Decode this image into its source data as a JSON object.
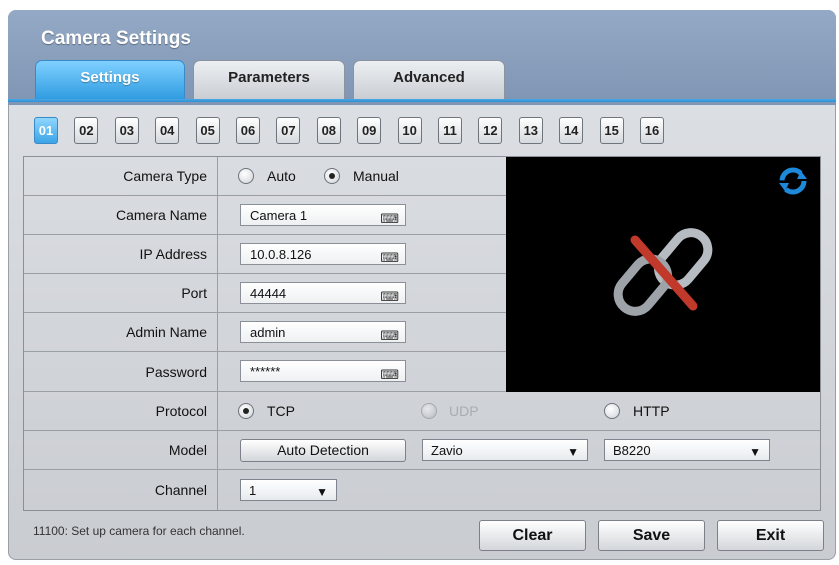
{
  "window": {
    "title": "Camera Settings"
  },
  "tabs": [
    {
      "label": "Settings",
      "active": true
    },
    {
      "label": "Parameters",
      "active": false
    },
    {
      "label": "Advanced",
      "active": false
    }
  ],
  "channels": {
    "items": [
      "01",
      "02",
      "03",
      "04",
      "05",
      "06",
      "07",
      "08",
      "09",
      "10",
      "11",
      "12",
      "13",
      "14",
      "15",
      "16"
    ],
    "selected": "01"
  },
  "form": {
    "camera_type": {
      "label": "Camera Type",
      "options": [
        "Auto",
        "Manual"
      ],
      "selected": "Manual"
    },
    "camera_name": {
      "label": "Camera Name",
      "value": "Camera 1"
    },
    "ip_address": {
      "label": "IP Address",
      "value": "10.0.8.126"
    },
    "port": {
      "label": "Port",
      "value": "44444"
    },
    "admin_name": {
      "label": "Admin Name",
      "value": "admin"
    },
    "password": {
      "label": "Password",
      "value": "******"
    },
    "protocol": {
      "label": "Protocol",
      "options": [
        "TCP",
        "UDP",
        "HTTP"
      ],
      "selected": "TCP",
      "disabled": [
        "UDP"
      ]
    },
    "model": {
      "label": "Model",
      "auto_detect_label": "Auto Detection",
      "brand": "Zavio",
      "model": "B8220"
    },
    "channel": {
      "label": "Channel",
      "value": "1"
    }
  },
  "preview": {
    "status_icon": "broken-link-icon",
    "refresh_icon": "refresh-icon"
  },
  "status_text": "11100: Set up camera for each channel.",
  "buttons": {
    "clear": "Clear",
    "save": "Save",
    "exit": "Exit"
  },
  "icons": {
    "keyboard": "keyboard-icon",
    "dropdown": "chevron-down-icon"
  },
  "colors": {
    "accent": "#2e9be0",
    "titlebar": "#8aa0bd",
    "link_broken": "#c0392b",
    "refresh": "#1e88d9"
  }
}
